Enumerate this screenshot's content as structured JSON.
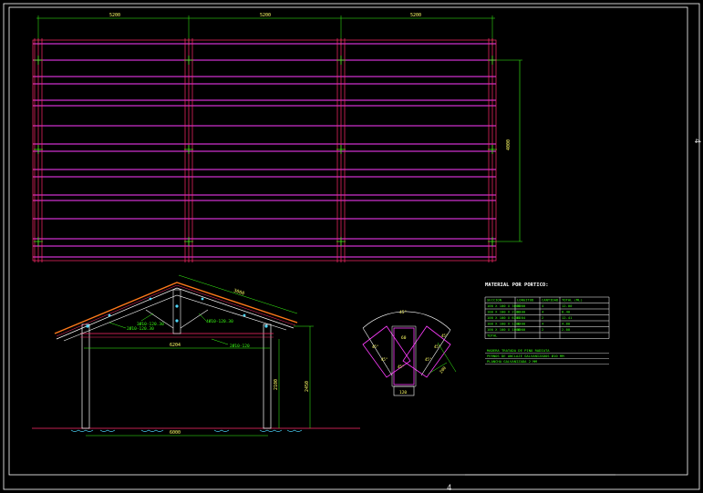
{
  "sheet": {
    "corner_mark_right": "4",
    "corner_mark_bottom": "4"
  },
  "plan": {
    "dim_top": [
      "5200",
      "5200",
      "5200"
    ],
    "dim_right": "4000"
  },
  "elevation": {
    "dim_rafter": "3000",
    "dim_tie": "6204",
    "dim_height": "2450",
    "dim_post": "2100",
    "dim_base": "6000",
    "labels": [
      "2Ø10-120.30",
      "3Ø10-120.30",
      "4Ø10-120.30",
      "2Ø10-120"
    ]
  },
  "joint": {
    "labels": [
      "45°",
      "60",
      "200",
      "120",
      "45°",
      "45°",
      "45°",
      "45°",
      "45°",
      "45°"
    ]
  },
  "materials": {
    "title": "MATERIAL POR PORTICO:",
    "headers": [
      "SECCION",
      "LONGITUD",
      "CANTIDAD",
      "TOTAL (ML)"
    ],
    "rows": [
      [
        "100 X 100 X 3000",
        "3000",
        "4",
        "12.00"
      ],
      [
        "100 X 100 X 2100",
        "2100",
        "4",
        "8.40"
      ],
      [
        "100 X 100 X 6204",
        "6204",
        "2",
        "12.41"
      ],
      [
        "100 X 100 X 1200",
        "1200",
        "4",
        "4.80"
      ],
      [
        "100 X 100 X 1000",
        "1000",
        "2",
        "2.00"
      ],
      [
        "TOTAL",
        "",
        "",
        ""
      ]
    ],
    "notes": [
      "MADERA TRATADA DE PINO RADIATA",
      "PERNOS DE ANCLAJE GALVANIZADOS Ø10 MM",
      "PLANCHA GALVANIZADA 2 MM"
    ]
  },
  "colors": {
    "frame": "#ffffff",
    "beam": "#ff2a6a",
    "purlin": "#ff3dff",
    "dimension": "#39ff14",
    "text_yellow": "#ffff66",
    "cyan": "#4fd9ff",
    "roof": "#ff7a1a"
  }
}
